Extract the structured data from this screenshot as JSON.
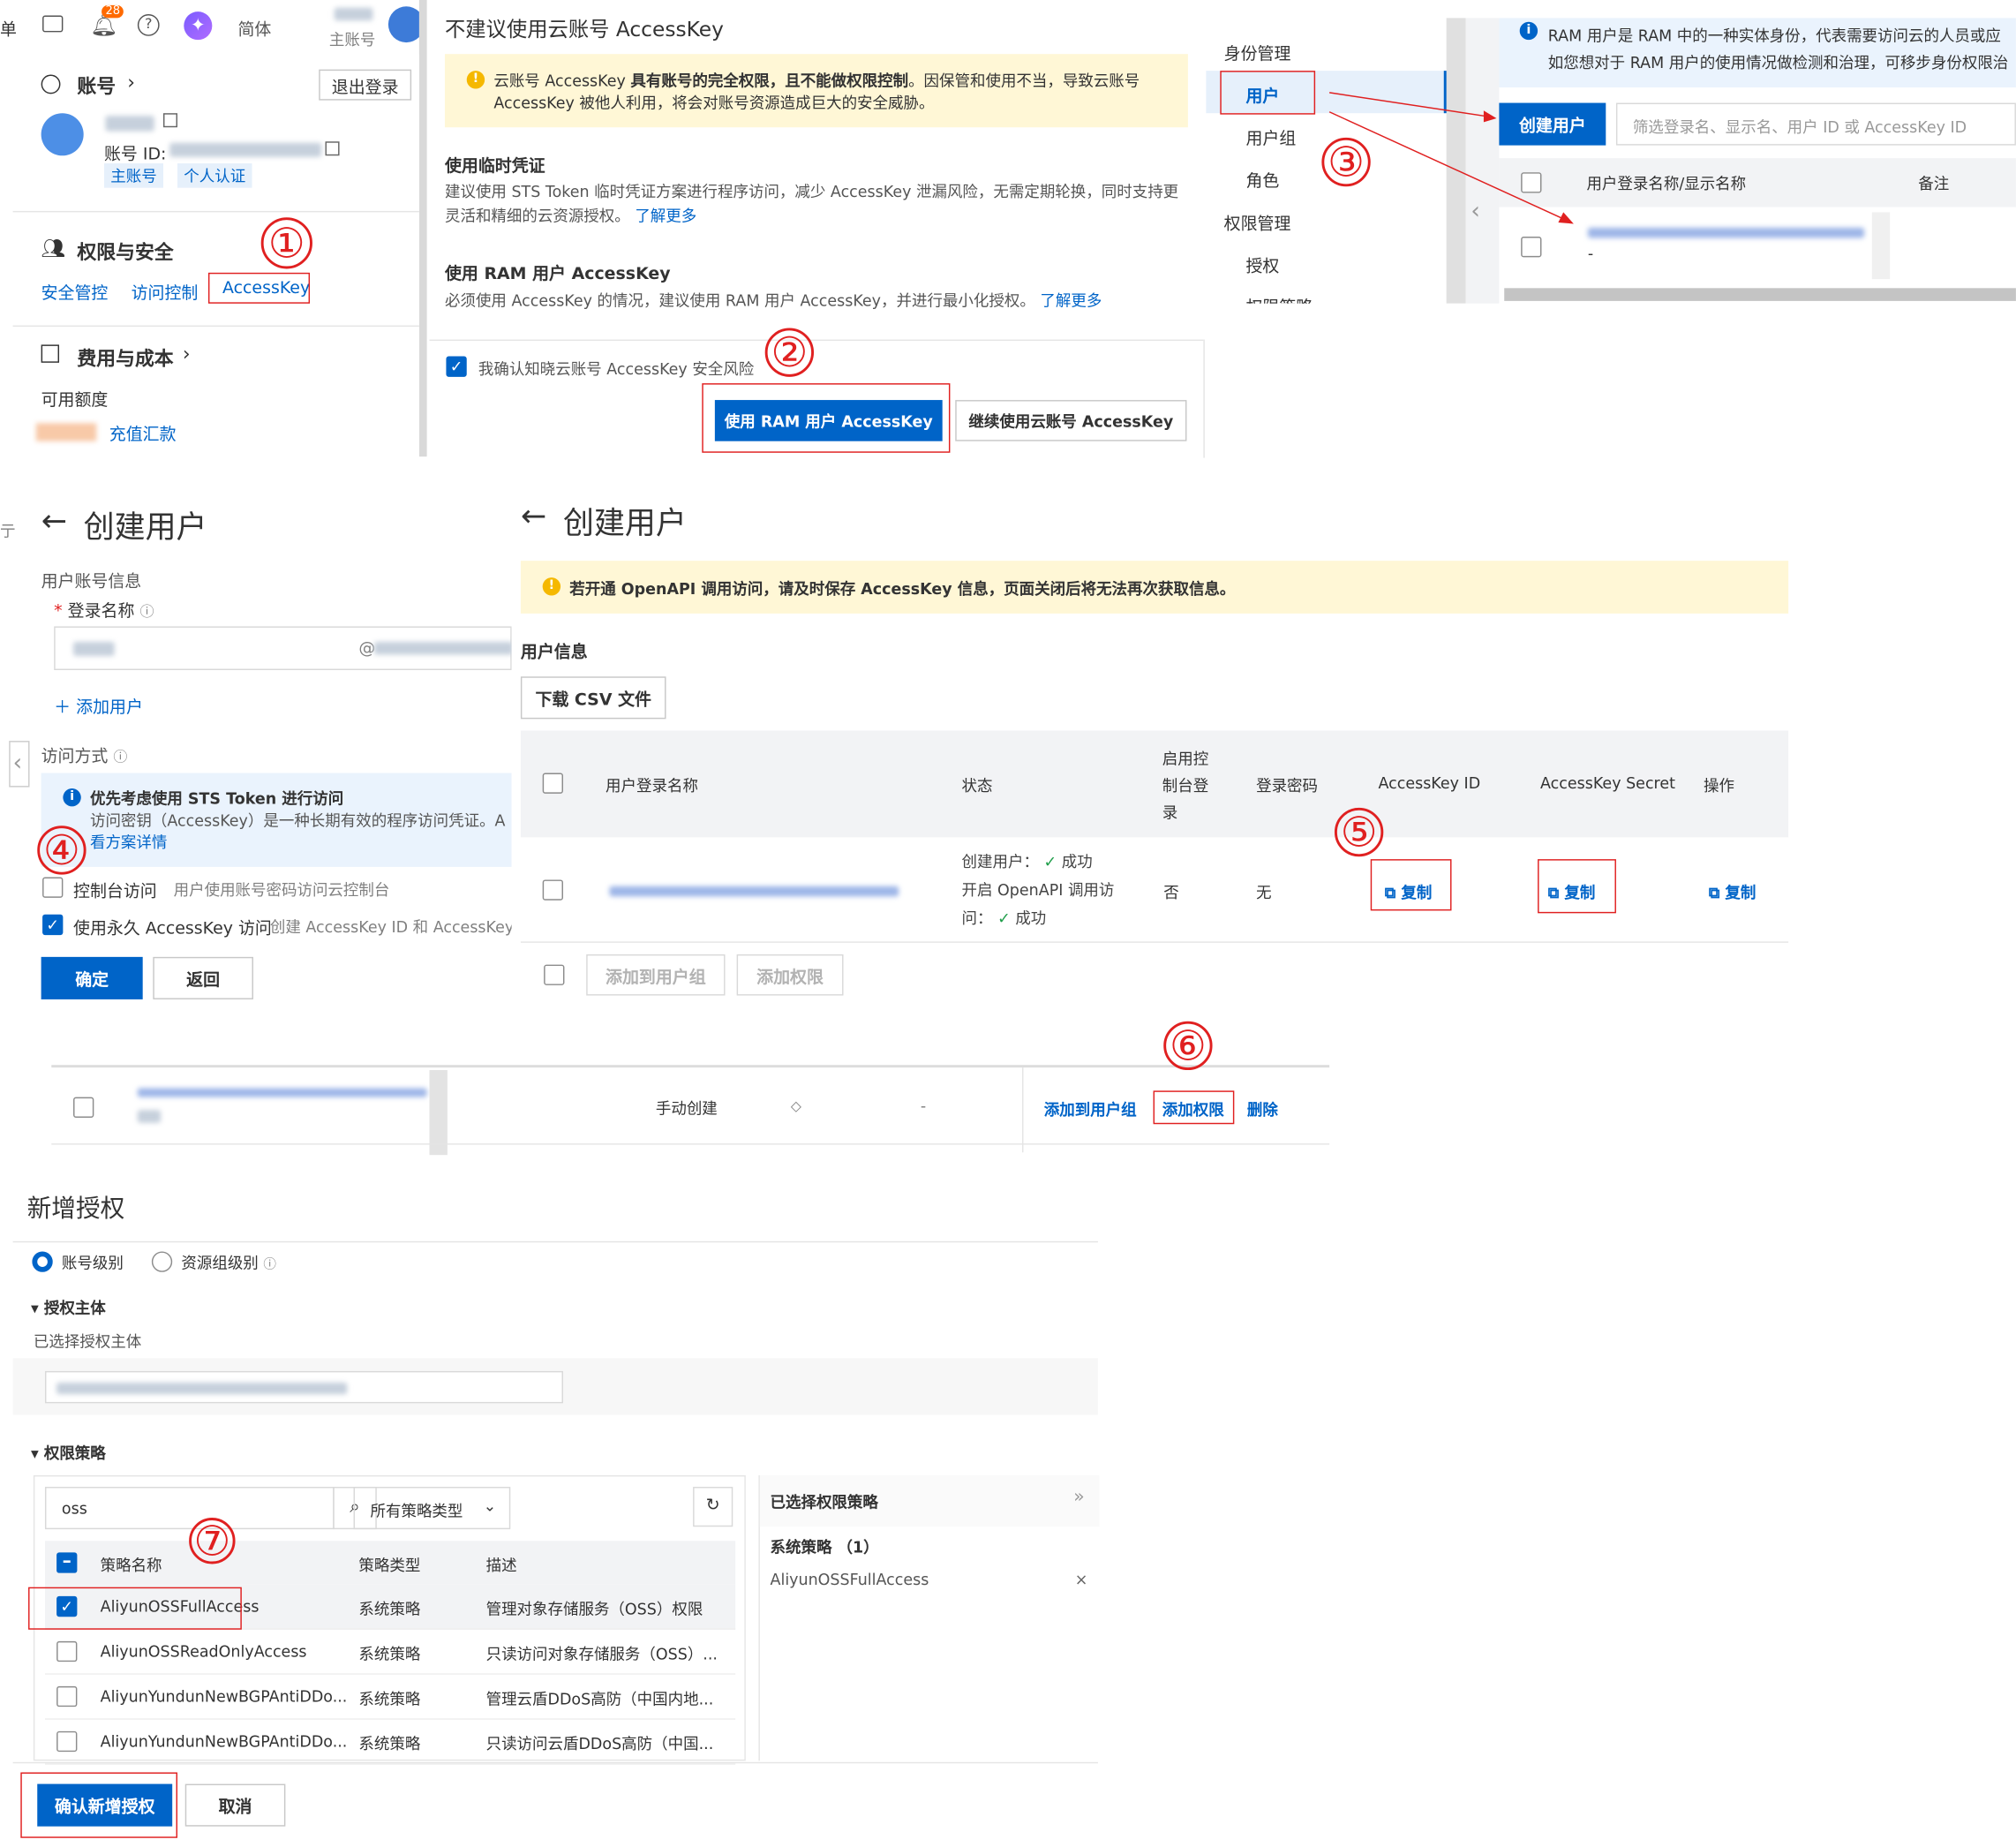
{
  "topbar": {
    "menu_fragment": "单",
    "notification_count": "28",
    "language": "简体",
    "account_type": "主账号"
  },
  "account_panel": {
    "title": "账号",
    "logout": "退出登录",
    "account_id_label": "账号 ID:",
    "tag_main": "主账号",
    "tag_personal": "个人认证",
    "security_title": "权限与安全",
    "security_links": [
      "安全管控",
      "访问控制",
      "AccessKey"
    ],
    "cost_title": "费用与成本",
    "available_credit": "可用额度",
    "recharge": "充值汇款"
  },
  "accesskey_dialog": {
    "title": "不建议使用云账号 AccessKey",
    "warning_prefix": "云账号 AccessKey ",
    "warning_bold": "具有账号的完全权限，且不能做权限控制",
    "warning_rest": "。因保管和使用不当，导致云账号",
    "warning_line2": "AccessKey 被他人利用，将会对账号资源造成巨大的安全威胁。",
    "sts_title": "使用临时凭证",
    "sts_line1": "建议使用 STS Token 临时凭证方案进行程序访问，减少 AccessKey 泄漏风险，无需定期轮换，同时支持更",
    "sts_line2": "灵活和精细的云资源授权。",
    "learn_more": "了解更多",
    "ram_title": "使用 RAM 用户 AccessKey",
    "ram_desc": "必须使用 AccessKey 的情况，建议使用 RAM 用户 AccessKey，并进行最小化授权。",
    "confirm_risk": "我确认知晓云账号 AccessKey 安全风险",
    "use_ram_button": "使用 RAM 用户 AccessKey",
    "continue_button": "继续使用云账号 AccessKey"
  },
  "ram_nav": {
    "identity": "身份管理",
    "users": "用户",
    "groups": "用户组",
    "roles": "角色",
    "permissions": "权限管理",
    "grants": "授权",
    "policies": "权限策略"
  },
  "ram_users": {
    "info_line1": "RAM 用户是 RAM 中的一种实体身份，代表需要访问云的人员或应",
    "info_line2": "如您想对于 RAM 用户的使用情况做检测和治理，可移步身份权限治",
    "create_user": "创建用户",
    "search_placeholder": "筛选登录名、显示名、用户 ID 或 AccessKey ID",
    "col_name": "用户登录名称/显示名称",
    "col_note": "备注",
    "row_dash": "-"
  },
  "create_user_form": {
    "title": "创建用户",
    "account_info": "用户账号信息",
    "login_name": "登录名称",
    "domain_at": "@",
    "add_user": "添加用户",
    "access_mode": "访问方式",
    "sts_tip_title": "优先考虑使用 STS Token 进行访问",
    "sts_tip_desc": "访问密钥（AccessKey）是一种长期有效的程序访问凭证。A",
    "sts_tip_link": "看方案详情",
    "console_access": "控制台访问",
    "console_access_desc": "用户使用账号密码访问云控制台",
    "permanent_ak": "使用永久 AccessKey 访问",
    "permanent_ak_desc": "创建 AccessKey ID 和 AccessKey S",
    "ok": "确定",
    "back": "返回"
  },
  "create_user_result": {
    "title": "创建用户",
    "warning": "若开通 OpenAPI 调用访问，请及时保存 AccessKey 信息，页面关闭后将无法再次获取信息。",
    "user_info": "用户信息",
    "download_csv": "下载 CSV 文件",
    "columns": [
      "用户登录名称",
      "状态",
      "启用控制台登录",
      "登录密码",
      "AccessKey ID",
      "AccessKey Secret",
      "操作"
    ],
    "status_line1": "创建用户：",
    "status_line2": "开启 OpenAPI 调用访",
    "status_line3": "问：",
    "success": "成功",
    "console_enabled": "否",
    "password": "无",
    "copy": "复制",
    "add_to_group": "添加到用户组",
    "add_permission": "添加权限"
  },
  "user_row": {
    "created_by": "手动创建",
    "dash": "-",
    "add_to_group": "添加到用户组",
    "add_permission": "添加权限",
    "delete": "删除"
  },
  "grant": {
    "title": "新增授权",
    "scope_account": "账号级别",
    "scope_resource_group": "资源组级别",
    "principal_section": "授权主体",
    "selected_principal": "已选择授权主体",
    "policy_section": "权限策略",
    "search_value": "oss",
    "policy_type_filter": "所有策略类型",
    "col_name": "策略名称",
    "col_type": "策略类型",
    "col_desc": "描述",
    "policies": [
      {
        "name": "AliyunOSSFullAccess",
        "type": "系统策略",
        "desc": "管理对象存储服务（OSS）权限",
        "checked": true
      },
      {
        "name": "AliyunOSSReadOnlyAccess",
        "type": "系统策略",
        "desc": "只读访问对象存储服务（OSS）...",
        "checked": false
      },
      {
        "name": "AliyunYundunNewBGPAntiDDo...",
        "type": "系统策略",
        "desc": "管理云盾DDoS高防（中国内地...",
        "checked": false
      },
      {
        "name": "AliyunYundunNewBGPAntiDDo...",
        "type": "系统策略",
        "desc": "只读访问云盾DDoS高防（中国...",
        "checked": false
      }
    ],
    "selected_title": "已选择权限策略",
    "system_policy_count": "系统策略 （1）",
    "selected_policy": "AliyunOSSFullAccess",
    "confirm": "确认新增授权",
    "cancel": "取消"
  },
  "step_markers": [
    "①",
    "②",
    "③",
    "④",
    "⑤",
    "⑥",
    "⑦"
  ],
  "colors": {
    "primary": "#0064c8",
    "annotation": "#e02020",
    "warning_bg": "#fff7d6",
    "success": "#1f9e4a"
  }
}
